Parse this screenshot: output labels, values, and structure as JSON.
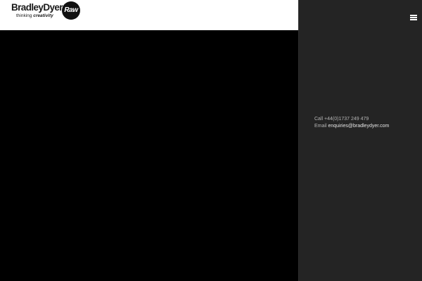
{
  "logo": {
    "wordmark": "BradleyDyer",
    "badge": "Raw",
    "tagline_prefix": "thinking",
    "tagline_emphasis": "creativity"
  },
  "contact": {
    "call_label": "Call",
    "phone": "+44(0)1737 249 479",
    "email_label": "Email",
    "email": "enquiries@bradleydyer.com"
  },
  "icons": {
    "menu": "hamburger-menu-icon"
  },
  "colors": {
    "header_bg": "#ffffff",
    "hero_bg": "#000000",
    "sidebar_bg": "#242424",
    "contact_text": "#b5b5b5"
  }
}
